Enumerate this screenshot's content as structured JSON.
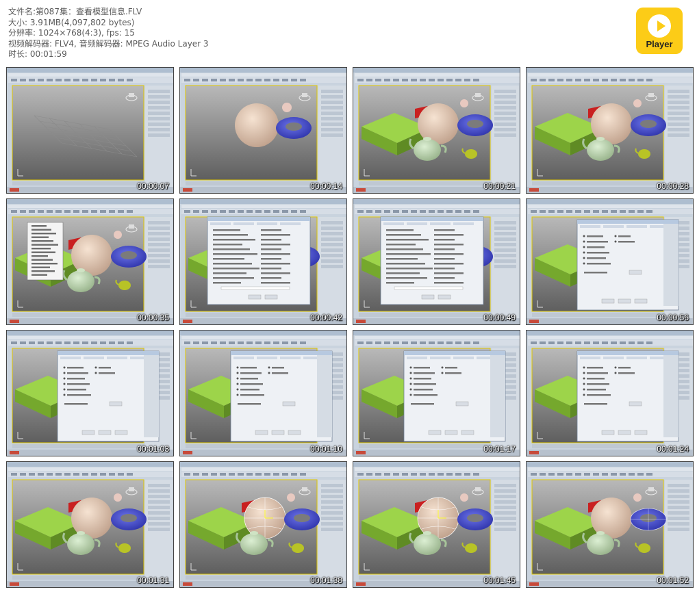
{
  "file_info": {
    "name": "文件名:第087集：查看模型信息.FLV",
    "size": "大小: 3.91MB(4,097,802 bytes)",
    "resolution": "分辨率: 1024×768(4:3), fps: 15",
    "codec": "视频解码器: FLV4, 音频解码器: MPEG Audio Layer 3",
    "duration": "时长: 00:01:59"
  },
  "logo": {
    "label": "Player",
    "icon": "play-icon",
    "color": "#fccc17"
  },
  "thumbnails": [
    {
      "time": "00:00:07",
      "scene": "empty"
    },
    {
      "time": "00:00:14",
      "scene": "sphere-torus"
    },
    {
      "time": "00:00:21",
      "scene": "full"
    },
    {
      "time": "00:00:28",
      "scene": "full"
    },
    {
      "time": "00:00:35",
      "scene": "context-menu"
    },
    {
      "time": "00:00:42",
      "scene": "dialog-large"
    },
    {
      "time": "00:00:49",
      "scene": "dialog-large"
    },
    {
      "time": "00:00:56",
      "scene": "dialog-small"
    },
    {
      "time": "00:01:03",
      "scene": "dialog-small"
    },
    {
      "time": "00:01:10",
      "scene": "dialog-small"
    },
    {
      "time": "00:01:17",
      "scene": "dialog-small"
    },
    {
      "time": "00:01:24",
      "scene": "dialog-small"
    },
    {
      "time": "00:01:31",
      "scene": "full"
    },
    {
      "time": "00:01:38",
      "scene": "selected-sphere"
    },
    {
      "time": "00:01:45",
      "scene": "selected-sphere"
    },
    {
      "time": "00:01:52",
      "scene": "selected-torus"
    }
  ]
}
